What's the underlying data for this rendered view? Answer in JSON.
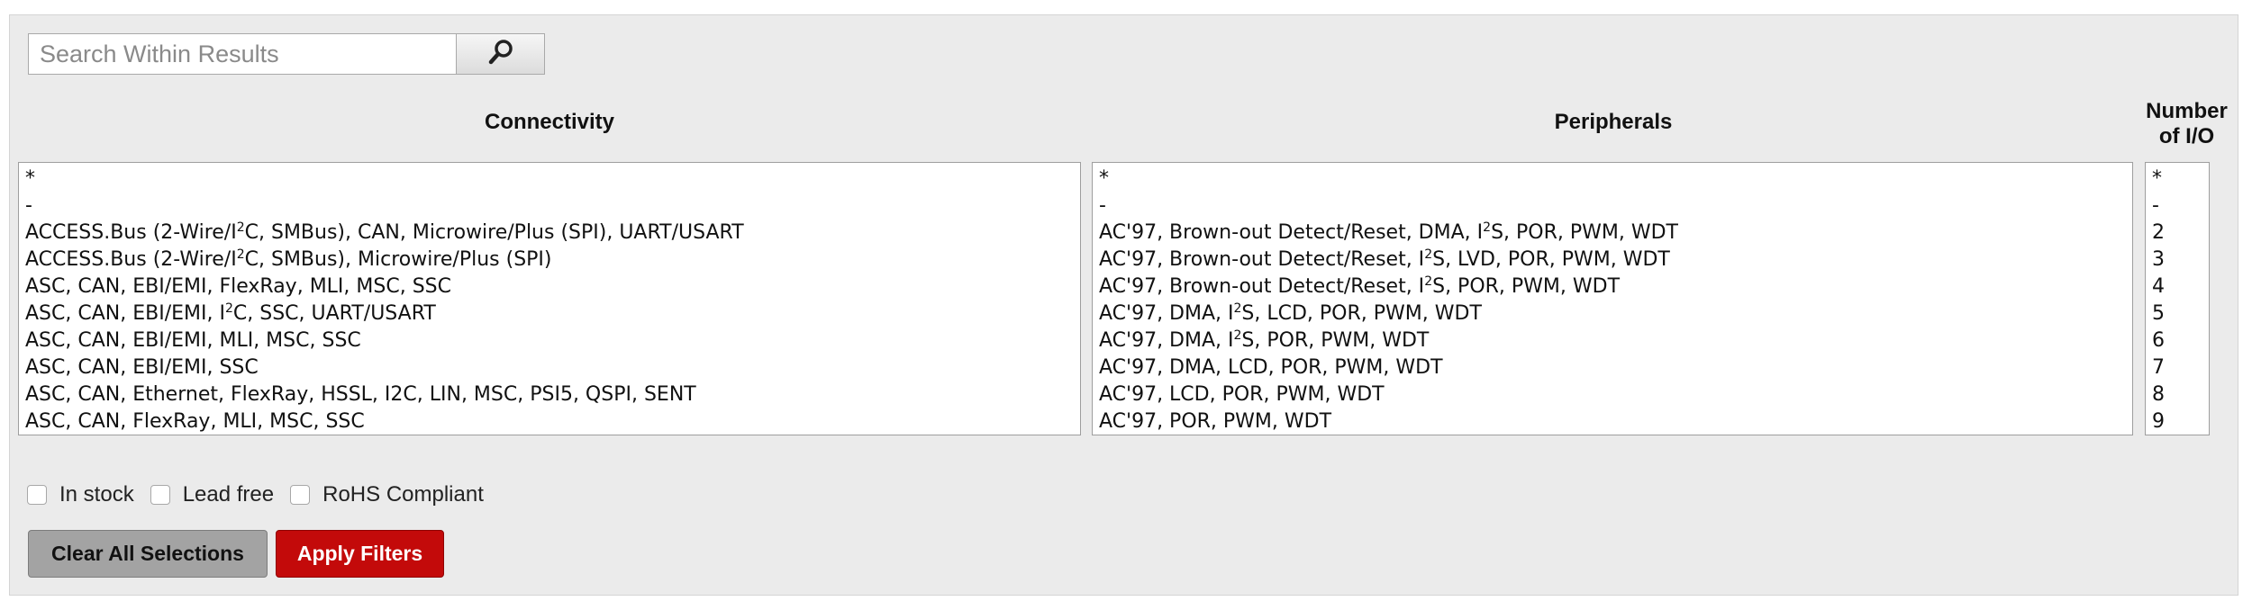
{
  "search": {
    "placeholder": "Search Within Results",
    "value": ""
  },
  "columns": [
    {
      "header": "Connectivity",
      "options": [
        "*",
        "-",
        "ACCESS.Bus (2-Wire/I<sup>2</sup>C, SMBus), CAN, Microwire/Plus (SPI), UART/USART",
        "ACCESS.Bus (2-Wire/I<sup>2</sup>C, SMBus), Microwire/Plus (SPI)",
        "ASC, CAN, EBI/EMI, FlexRay, MLI, MSC, SSC",
        "ASC, CAN, EBI/EMI, I<sup>2</sup>C, SSC, UART/USART",
        "ASC, CAN, EBI/EMI, MLI, MSC, SSC",
        "ASC, CAN, EBI/EMI, SSC",
        "ASC, CAN, Ethernet, FlexRay, HSSL, I2C, LIN, MSC, PSI5, QSPI, SENT",
        "ASC, CAN, FlexRay, MLI, MSC, SSC"
      ]
    },
    {
      "header": "Peripherals",
      "options": [
        "*",
        "-",
        "AC'97, Brown-out Detect/Reset, DMA, I<sup>2</sup>S, POR, PWM, WDT",
        "AC'97, Brown-out Detect/Reset, I<sup>2</sup>S, LVD, POR, PWM, WDT",
        "AC'97, Brown-out Detect/Reset, I<sup>2</sup>S, POR, PWM, WDT",
        "AC'97, DMA, I<sup>2</sup>S, LCD, POR, PWM, WDT",
        "AC'97, DMA, I<sup>2</sup>S, POR, PWM, WDT",
        "AC'97, DMA, LCD, POR, PWM, WDT",
        "AC'97, LCD, POR, PWM, WDT",
        "AC'97, POR, PWM, WDT"
      ]
    },
    {
      "header_line1": "Number",
      "header_line2": "of I/O",
      "options": [
        "*",
        "-",
        "2",
        "3",
        "4",
        "5",
        "6",
        "7",
        "8",
        "9"
      ]
    }
  ],
  "checkboxes": [
    {
      "label": "In stock",
      "checked": false
    },
    {
      "label": "Lead free",
      "checked": false
    },
    {
      "label": "RoHS Compliant",
      "checked": false
    }
  ],
  "buttons": {
    "clear_label": "Clear All Selections",
    "apply_label": "Apply Filters"
  },
  "icons": {
    "search": "search-icon"
  },
  "colors": {
    "apply_button": "#c30a0a",
    "clear_button": "#a3a3a3",
    "panel_background": "#ebebeb"
  }
}
